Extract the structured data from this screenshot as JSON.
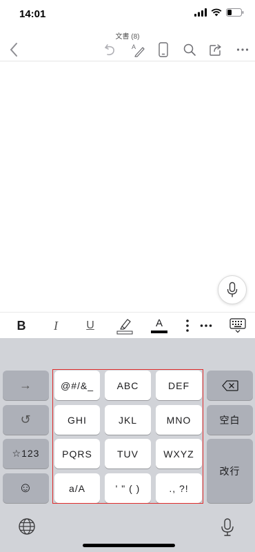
{
  "status_bar": {
    "time": "14:01"
  },
  "document": {
    "title": "文書 (8)"
  },
  "format_bar": {
    "bold": "B",
    "italic": "I",
    "underline": "U",
    "font_color": "A"
  },
  "keyboard": {
    "left": {
      "arrow": "→",
      "undo": "↺",
      "symbols": "☆123",
      "emoji": "☺"
    },
    "keys": [
      [
        "@#/&_",
        "ABC",
        "DEF"
      ],
      [
        "GHI",
        "JKL",
        "MNO"
      ],
      [
        "PQRS",
        "TUV",
        "WXYZ"
      ],
      [
        "a/A",
        "' \" ( )",
        "., ?!"
      ]
    ],
    "right": {
      "space": "空白",
      "return": "改行"
    }
  }
}
